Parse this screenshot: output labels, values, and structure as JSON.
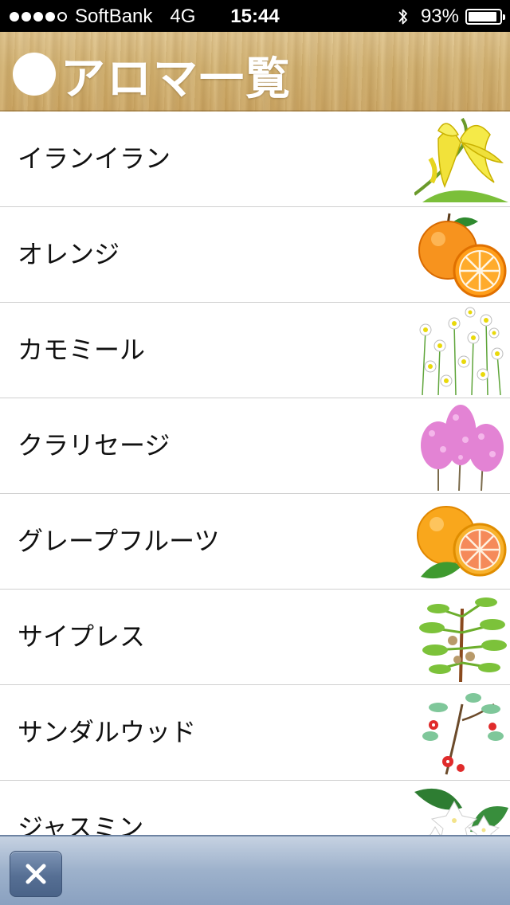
{
  "status_bar": {
    "carrier": "SoftBank",
    "network": "4G",
    "time": "15:44",
    "battery": "93%",
    "battery_level": 0.93,
    "signal_bars_filled": 4,
    "signal_bars_total": 5,
    "icons": [
      "bluetooth-icon",
      "battery-icon"
    ]
  },
  "header": {
    "title": "アロマ一覧"
  },
  "list": {
    "items": [
      {
        "label": "イランイラン",
        "icon": "ylang-ylang-flower-icon"
      },
      {
        "label": "オレンジ",
        "icon": "orange-fruit-icon"
      },
      {
        "label": "カモミール",
        "icon": "chamomile-flowers-icon"
      },
      {
        "label": "クラリセージ",
        "icon": "clary-sage-icon"
      },
      {
        "label": "グレープフルーツ",
        "icon": "grapefruit-icon"
      },
      {
        "label": "サイプレス",
        "icon": "cypress-branch-icon"
      },
      {
        "label": "サンダルウッド",
        "icon": "sandalwood-branch-icon"
      },
      {
        "label": "ジャスミン",
        "icon": "jasmine-flower-icon"
      }
    ]
  },
  "toolbar": {
    "close_icon": "close-icon"
  },
  "colors": {
    "header_wood": "#cfae6e",
    "toolbar": "#9db1cb",
    "separator": "#d0d0d0"
  }
}
